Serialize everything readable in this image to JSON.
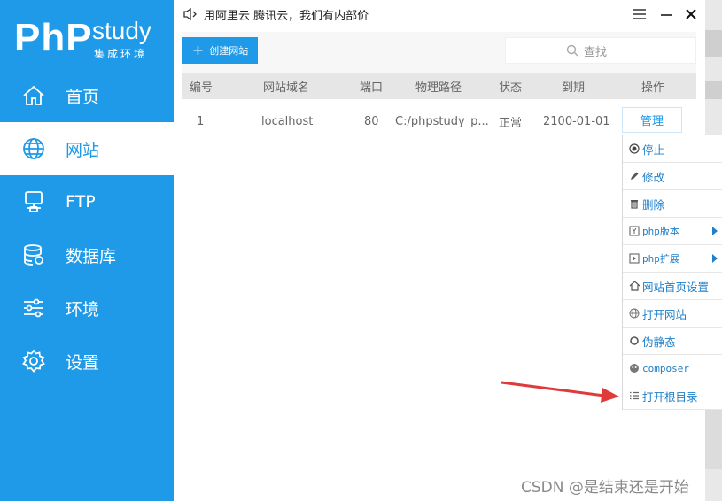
{
  "app": {
    "logo_main": "PhP",
    "logo_study": "study",
    "logo_sub": "集成环境",
    "notice": "用阿里云 腾讯云，我们有内部价"
  },
  "sidebar": {
    "items": [
      {
        "label": "首页",
        "icon": "home-icon"
      },
      {
        "label": "网站",
        "icon": "globe-icon",
        "active": true
      },
      {
        "label": "FTP",
        "icon": "server-icon"
      },
      {
        "label": "数据库",
        "icon": "database-icon"
      },
      {
        "label": "环境",
        "icon": "sliders-icon"
      },
      {
        "label": "设置",
        "icon": "gear-icon"
      }
    ]
  },
  "toolbar": {
    "create_label": "创建网站",
    "search_placeholder": "查找"
  },
  "table": {
    "columns": [
      "编号",
      "网站域名",
      "端口",
      "物理路径",
      "状态",
      "到期",
      "操作"
    ],
    "rows": [
      {
        "id": "1",
        "domain": "localhost",
        "port": "80",
        "path": "C:/phpstudy_p...",
        "status": "正常",
        "expire": "2100-01-01",
        "action": "管理"
      }
    ]
  },
  "context_menu": {
    "items": [
      {
        "label": "停止",
        "icon": "stop-icon"
      },
      {
        "label": "修改",
        "icon": "pencil-icon"
      },
      {
        "label": "删除",
        "icon": "trash-icon"
      },
      {
        "label": "php版本",
        "icon": "php-version-icon",
        "submenu": true
      },
      {
        "label": "php扩展",
        "icon": "php-extension-icon",
        "submenu": true
      },
      {
        "label": "网站首页设置",
        "icon": "home-icon"
      },
      {
        "label": "打开网站",
        "icon": "globe-icon"
      },
      {
        "label": "伪静态",
        "icon": "refresh-icon"
      },
      {
        "label": "composer",
        "icon": "composer-icon"
      },
      {
        "label": "打开根目录",
        "icon": "list-icon"
      }
    ]
  },
  "watermark": "CSDN @是结束还是开始",
  "colors": {
    "accent": "#1f9ae8",
    "arrow": "#e03a3a"
  }
}
